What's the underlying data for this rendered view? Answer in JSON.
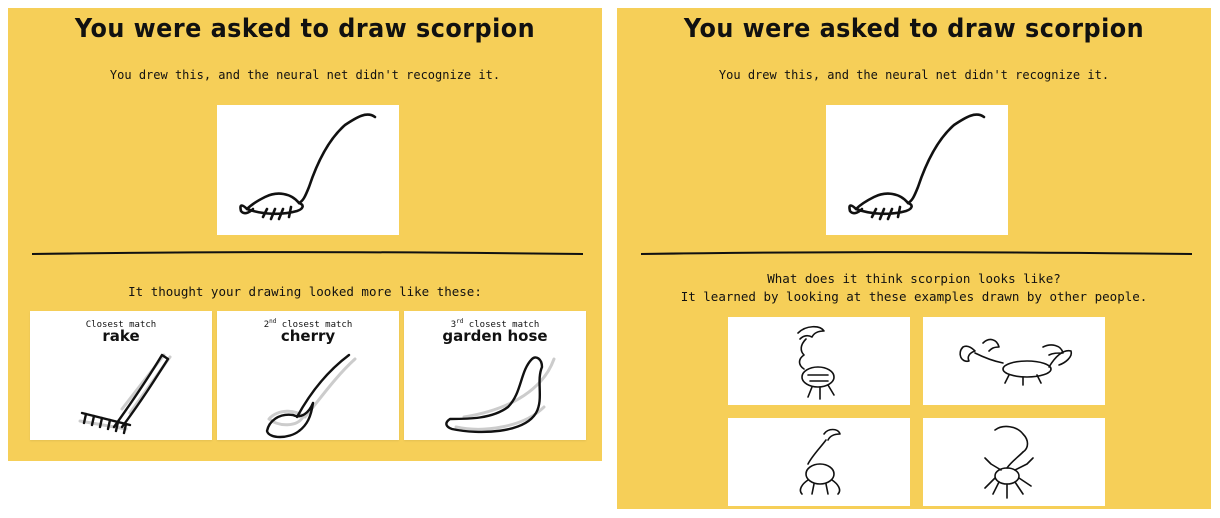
{
  "left_panel": {
    "title": "You were asked to draw scorpion",
    "subtitle": "You drew this, and the neural net didn't recognize it.",
    "prompt": "It thought your drawing looked more like these:",
    "matches": [
      {
        "rank_num": "",
        "rank_sup": "",
        "rank_text": "Closest match",
        "name": "rake"
      },
      {
        "rank_num": "2",
        "rank_sup": "nd",
        "rank_text": " closest match",
        "name": "cherry"
      },
      {
        "rank_num": "3",
        "rank_sup": "rd",
        "rank_text": " closest match",
        "name": "garden hose"
      }
    ]
  },
  "right_panel": {
    "title": "You were asked to draw scorpion",
    "subtitle": "You drew this, and the neural net didn't recognize it.",
    "prompt_line1": "What does it think scorpion looks like?",
    "prompt_line2": "It learned by looking at these examples drawn by other people."
  },
  "colors": {
    "panel_background": "#f6cf58",
    "card_background": "#ffffff",
    "ink": "#111111",
    "ghost_ink": "#cccccc"
  }
}
